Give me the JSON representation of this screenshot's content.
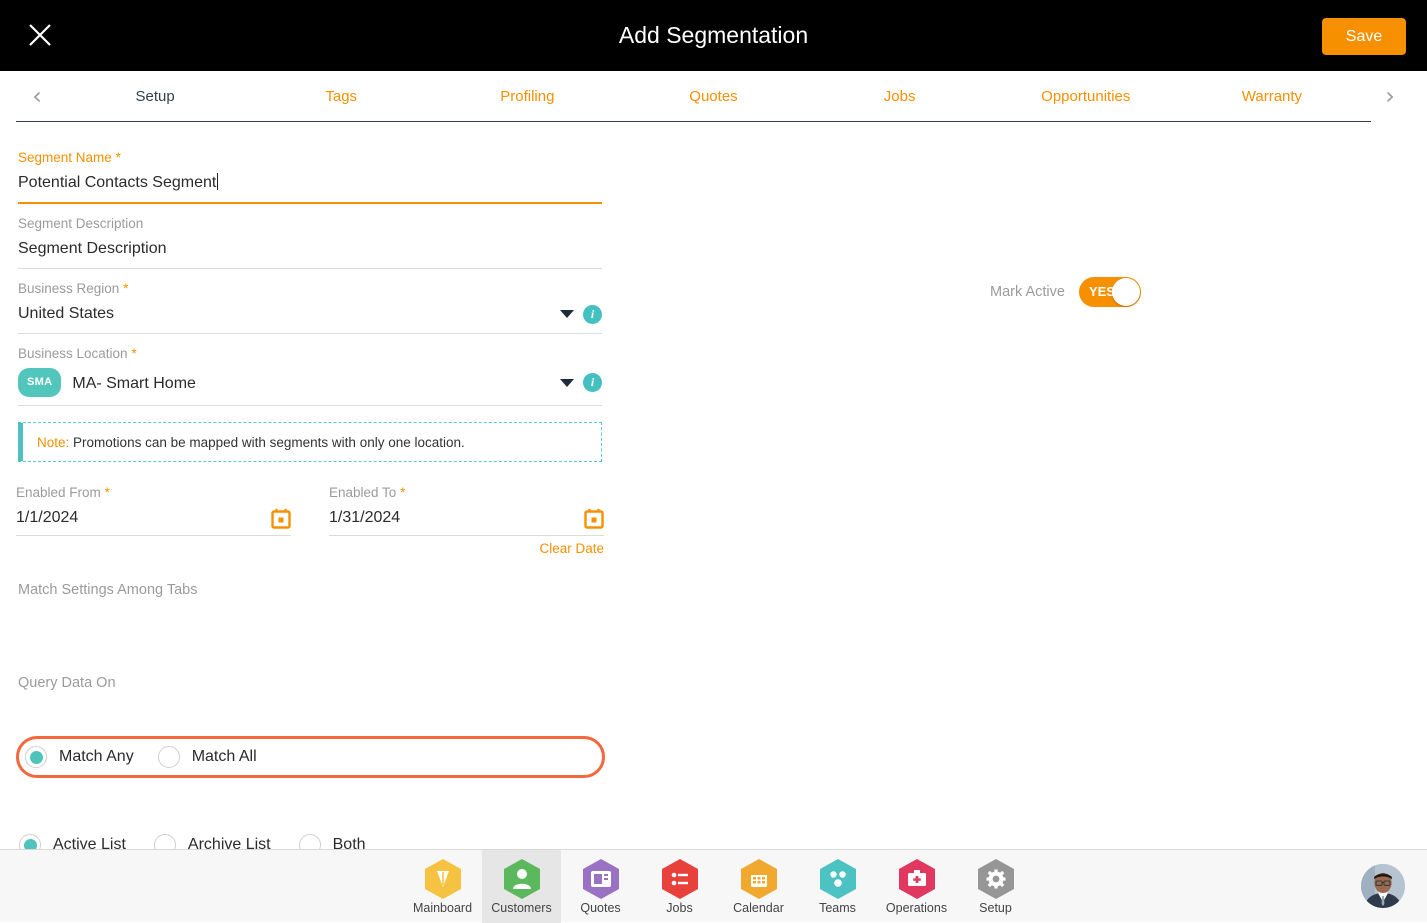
{
  "header": {
    "title": "Add Segmentation",
    "close_icon": "close-icon",
    "save_label": "Save"
  },
  "tabs": {
    "prev_arrow": "chevron-left-icon",
    "next_arrow": "chevron-right-icon",
    "items": [
      {
        "label": "Setup",
        "active": true
      },
      {
        "label": "Tags",
        "active": false
      },
      {
        "label": "Profiling",
        "active": false
      },
      {
        "label": "Quotes",
        "active": false
      },
      {
        "label": "Jobs",
        "active": false
      },
      {
        "label": "Opportunities",
        "active": false
      },
      {
        "label": "Warranty",
        "active": false
      }
    ]
  },
  "form": {
    "segment_name": {
      "label": "Segment Name",
      "required": "*",
      "value": "Potential Contacts Segment"
    },
    "segment_description": {
      "label": "Segment Description",
      "value": "Segment Description"
    },
    "business_region": {
      "label": "Business Region",
      "required": "*",
      "value": "United States",
      "caret_icon": "chevron-down-icon",
      "info_icon": "info-icon",
      "info_glyph": "i"
    },
    "business_location": {
      "label": "Business Location",
      "required": "*",
      "badge": "SMA",
      "value": "MA- Smart Home",
      "caret_icon": "chevron-down-icon",
      "info_icon": "info-icon",
      "info_glyph": "i"
    },
    "note": {
      "label": "Note:",
      "text": "Promotions can be mapped with segments with only one location."
    },
    "enabled_from": {
      "label": "Enabled From",
      "required": "*",
      "value": "1/1/2024",
      "calendar_icon": "calendar-icon"
    },
    "enabled_to": {
      "label": "Enabled To",
      "required": "*",
      "value": "1/31/2024",
      "calendar_icon": "calendar-icon"
    },
    "clear_date_label": "Clear Date",
    "match_settings": {
      "label": "Match Settings Among Tabs",
      "options": [
        {
          "label": "Match Any",
          "selected": true
        },
        {
          "label": "Match All",
          "selected": false
        }
      ]
    },
    "query_data_on": {
      "label": "Query Data On",
      "options": [
        {
          "label": "Active List",
          "selected": true
        },
        {
          "label": "Archive List",
          "selected": false
        },
        {
          "label": "Both",
          "selected": false
        }
      ]
    },
    "mark_active": {
      "label": "Mark Active",
      "state": "YES"
    }
  },
  "bottom_nav": {
    "items": [
      {
        "label": "Mainboard",
        "icon": "mainboard-icon",
        "color": "#f5c242",
        "active": false
      },
      {
        "label": "Customers",
        "icon": "customers-icon",
        "color": "#5cb85c",
        "active": true
      },
      {
        "label": "Quotes",
        "icon": "quotes-icon",
        "color": "#9a72c4",
        "active": false
      },
      {
        "label": "Jobs",
        "icon": "jobs-icon",
        "color": "#e8413c",
        "active": false
      },
      {
        "label": "Calendar",
        "icon": "calendar-icon",
        "color": "#f0a92e",
        "active": false
      },
      {
        "label": "Teams",
        "icon": "teams-icon",
        "color": "#4cc2c2",
        "active": false
      },
      {
        "label": "Operations",
        "icon": "operations-icon",
        "color": "#e0385f",
        "active": false
      },
      {
        "label": "Setup",
        "icon": "setup-gear-icon",
        "color": "#969696",
        "active": false
      }
    ],
    "avatar": "user-avatar"
  },
  "colors": {
    "accent_orange": "#f79000",
    "teal": "#4ec4bd",
    "highlight_ring": "#f4683c",
    "dark_nav": "#35404e"
  }
}
